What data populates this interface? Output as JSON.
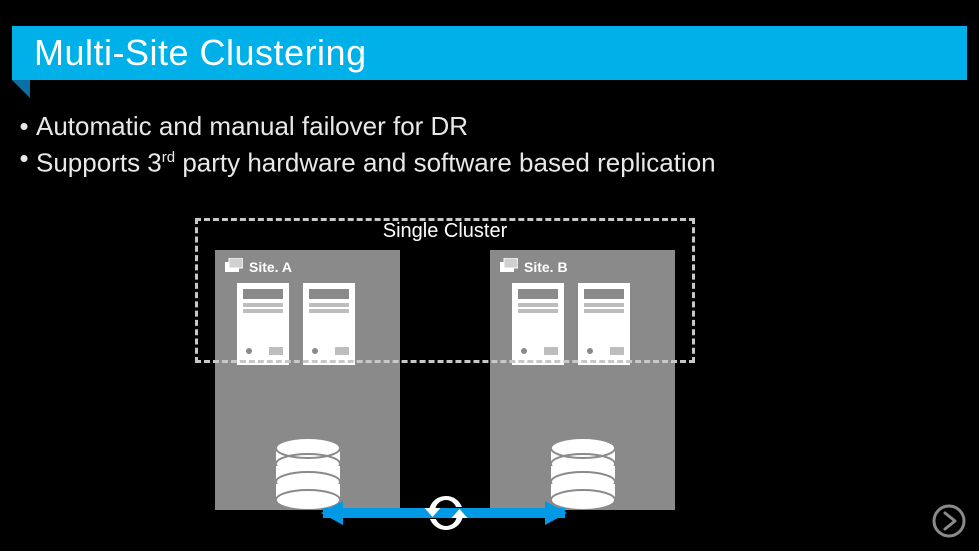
{
  "title": "Multi-Site Clustering",
  "bullets": {
    "b1": "Automatic and manual failover for DR",
    "b2_pre": "Supports 3",
    "b2_sup": "rd",
    "b2_post": " party hardware and software based replication"
  },
  "diagram": {
    "single_cluster": "Single Cluster",
    "site_a": "Site. A",
    "site_b": "Site. B"
  }
}
